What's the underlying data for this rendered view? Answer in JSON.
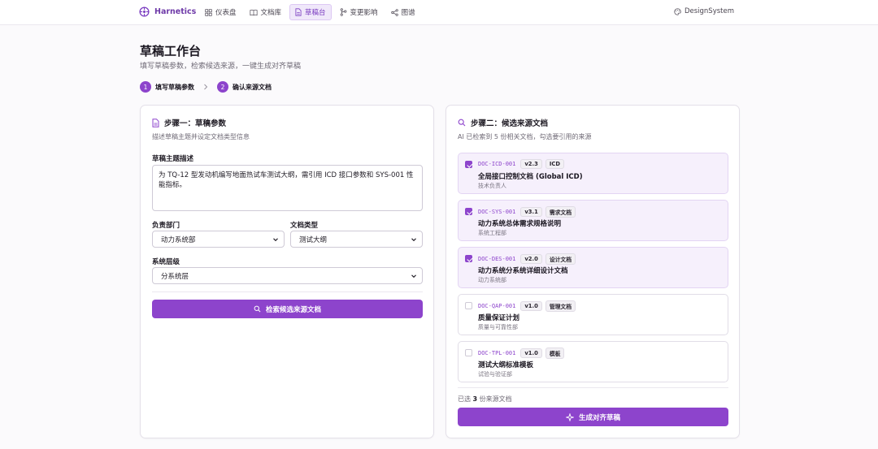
{
  "nav": {
    "brand": "Harnetics",
    "tabs": [
      {
        "label": "仪表盘",
        "icon": "dashboard-icon"
      },
      {
        "label": "文档库",
        "icon": "book-icon"
      },
      {
        "label": "草稿台",
        "icon": "draft-icon",
        "active": true
      },
      {
        "label": "变更影响",
        "icon": "branch-icon"
      },
      {
        "label": "图谱",
        "icon": "graph-icon"
      }
    ],
    "design_system": "DesignSystem"
  },
  "header": {
    "title": "草稿工作台",
    "subtitle": "填写草稿参数，检索候选来源，一键生成对齐草稿",
    "steps": [
      {
        "num": "1",
        "label": "填写草稿参数"
      },
      {
        "num": "2",
        "label": "确认来源文档"
      }
    ]
  },
  "left": {
    "title": "步骤一：草稿参数",
    "desc": "描述草稿主题并设定文档类型信息",
    "topic_label": "草稿主题描述",
    "topic_value": "为 TQ-12 型发动机编写地面热试车测试大纲，需引用 ICD 接口参数和 SYS-001 性能指标。",
    "dept_label": "负责部门",
    "dept_value": "动力系统部",
    "doctype_label": "文档类型",
    "doctype_value": "测试大纲",
    "level_label": "系统层级",
    "level_value": "分系统层",
    "search_button": "检索候选来源文档"
  },
  "right": {
    "title": "步骤二：候选来源文档",
    "desc": "AI 已检索到 5 份相关文档，勾选要引用的来源",
    "docs": [
      {
        "id": "DOC-ICD-001",
        "version": "v2.3",
        "type": "ICD",
        "name": "全局接口控制文档 (Global ICD)",
        "owner": "技术负责人",
        "checked": true
      },
      {
        "id": "DOC-SYS-001",
        "version": "v3.1",
        "type": "需求文档",
        "name": "动力系统总体需求规格说明",
        "owner": "系统工程部",
        "checked": true
      },
      {
        "id": "DOC-DES-001",
        "version": "v2.0",
        "type": "设计文档",
        "name": "动力系统分系统详细设计文档",
        "owner": "动力系统部",
        "checked": true
      },
      {
        "id": "DOC-QAP-001",
        "version": "v1.0",
        "type": "管理文档",
        "name": "质量保证计划",
        "owner": "质量与可靠性部",
        "checked": false
      },
      {
        "id": "DOC-TPL-001",
        "version": "v1.0",
        "type": "模板",
        "name": "测试大纲标准模板",
        "owner": "试验与验证部",
        "checked": false
      }
    ],
    "selected_prefix": "已选",
    "selected_count": "3",
    "selected_suffix": "份来源文档",
    "generate_button": "生成对齐草稿"
  },
  "colors": {
    "accent": "#8d44cc",
    "accent_light": "#f6f0fc"
  }
}
